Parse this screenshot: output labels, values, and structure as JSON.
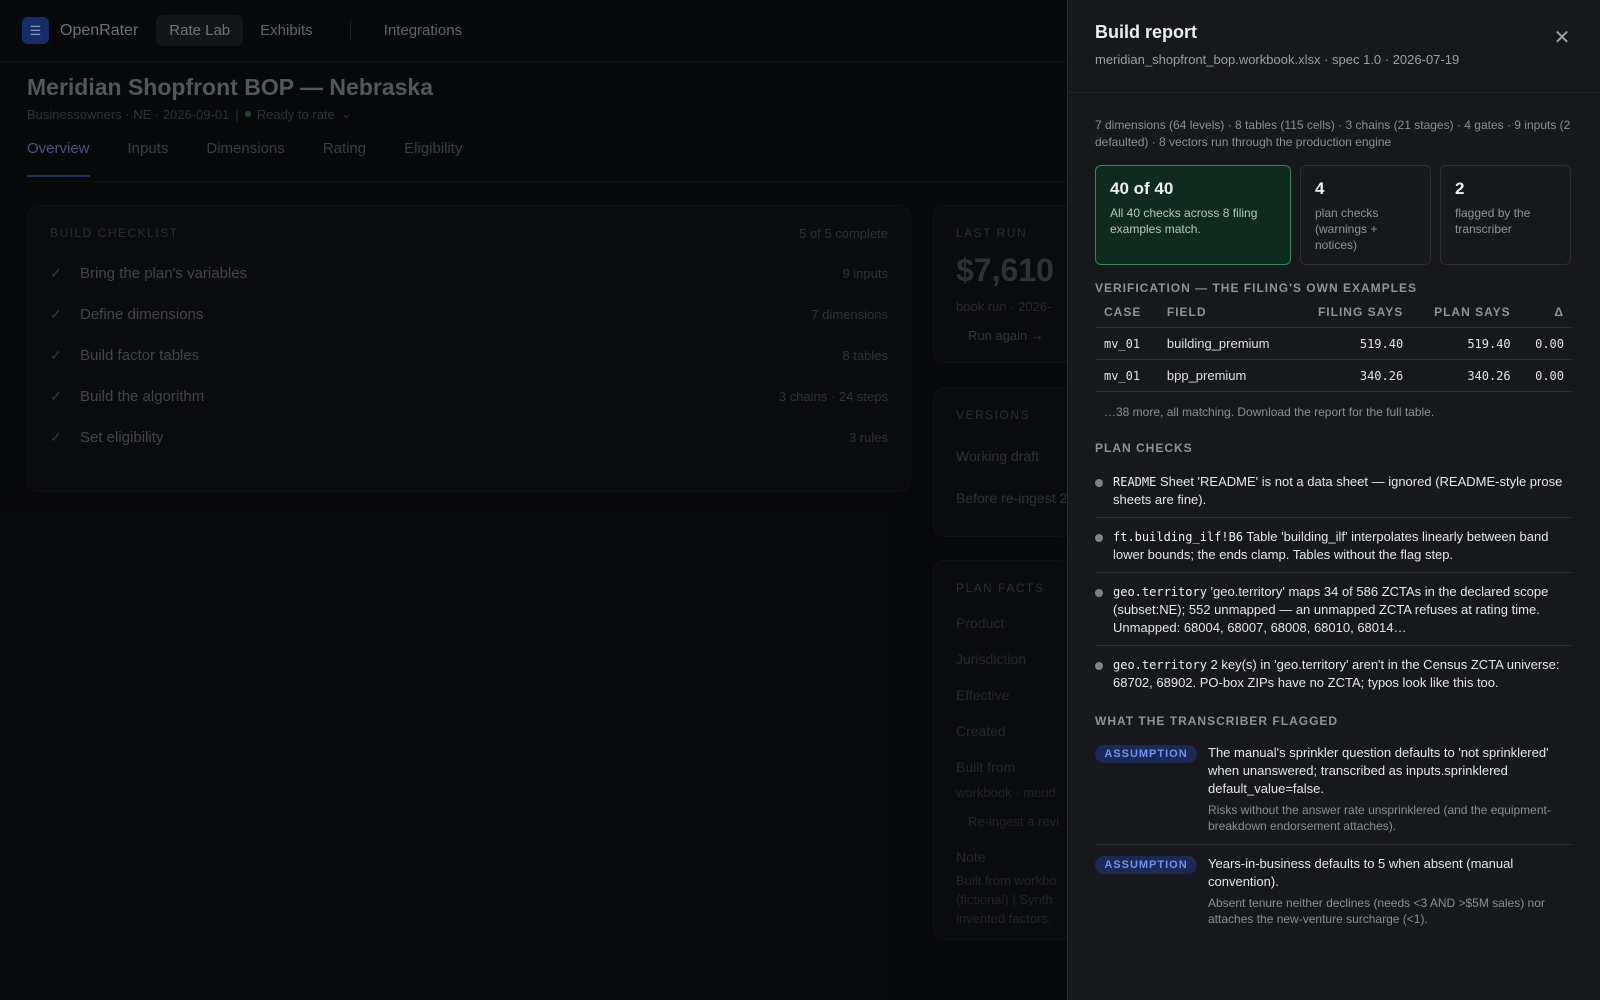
{
  "app": {
    "brand": "OpenRater",
    "nav": [
      "Rate Lab",
      "Exhibits",
      "Integrations"
    ],
    "page_title": "Meridian Shopfront BOP — Nebraska",
    "page_sub": "Businessowners · NE · 2026-09-01",
    "status": "Ready to rate",
    "tabs": [
      "Overview",
      "Inputs",
      "Dimensions",
      "Rating",
      "Eligibility"
    ],
    "checklist": {
      "title": "BUILD CHECKLIST",
      "count": "5 of 5 complete",
      "items": [
        {
          "label": "Bring the plan's variables",
          "meta": "9 inputs"
        },
        {
          "label": "Define dimensions",
          "meta": "7 dimensions"
        },
        {
          "label": "Build factor tables",
          "meta": "8 tables"
        },
        {
          "label": "Build the algorithm",
          "meta": "3 chains · 24 steps"
        },
        {
          "label": "Set eligibility",
          "meta": "3 rules"
        }
      ]
    },
    "last_run": {
      "title": "LAST RUN",
      "price": "$7,610",
      "sub": "book run · 2026-",
      "again": "Run again →"
    },
    "versions": {
      "title": "VERSIONS",
      "items": [
        "Working draft",
        "Before re-ingest 2"
      ]
    },
    "facts": {
      "title": "PLAN FACTS",
      "labels": [
        "Product",
        "Jurisdiction",
        "Effective",
        "Created",
        "Built from"
      ],
      "built_from_value": "workbook · merid",
      "reingest": "Re-ingest a revi",
      "note_label": "Note",
      "note_lines": [
        "Built from workbo",
        "(fictional) | Synth",
        "invented factors."
      ]
    }
  },
  "drawer": {
    "title": "Build report",
    "subtitle": "meridian_shopfront_bop.workbook.xlsx · spec 1.0 · 2026-07-19",
    "summary": "7 dimensions (64 levels) · 8 tables (115 cells) · 3 chains (21 stages) · 4 gates · 9 inputs (2 defaulted) · 8 vectors run through the production engine",
    "stats": [
      {
        "n": "40 of 40",
        "d": "All 40 checks across 8 filing examples match."
      },
      {
        "n": "4",
        "d": "plan checks (warnings + notices)"
      },
      {
        "n": "2",
        "d": "flagged by the transcriber"
      }
    ],
    "verification_title": "VERIFICATION — THE FILING'S OWN EXAMPLES",
    "columns": [
      "CASE",
      "FIELD",
      "FILING SAYS",
      "PLAN SAYS",
      "Δ"
    ],
    "rows": [
      {
        "case": "mv_01",
        "field": "building_premium",
        "filing": "519.40",
        "plan": "519.40",
        "delta": "0.00"
      },
      {
        "case": "mv_01",
        "field": "bpp_premium",
        "filing": "340.26",
        "plan": "340.26",
        "delta": "0.00"
      }
    ],
    "more": "…38 more, all matching. Download the report for the full table.",
    "plan_checks_title": "PLAN CHECKS",
    "plan_checks": [
      {
        "code": "README",
        "text": " Sheet 'README' is not a data sheet — ignored (README-style prose sheets are fine)."
      },
      {
        "code": "ft.building_ilf!B6",
        "text": " Table 'building_ilf' interpolates linearly between band lower bounds; the ends clamp. Tables without the flag step."
      },
      {
        "code": "geo.territory",
        "text": " 'geo.territory' maps 34 of 586 ZCTAs in the declared scope (subset:NE); 552 unmapped — an unmapped ZCTA refuses at rating time. Unmapped: 68004, 68007, 68008, 68010, 68014…"
      },
      {
        "code": "geo.territory",
        "text": " 2 key(s) in 'geo.territory' aren't in the Census ZCTA universe: 68702, 68902. PO-box ZIPs have no ZCTA; typos look like this too."
      }
    ],
    "flagged_title": "WHAT THE TRANSCRIBER FLAGGED",
    "flags": [
      {
        "badge": "ASSUMPTION",
        "main": "The manual's sprinkler question defaults to 'not sprinklered' when unanswered; transcribed as inputs.sprinklered default_value=false.",
        "note": "Risks without the answer rate unsprinklered (and the equipment-breakdown endorsement attaches)."
      },
      {
        "badge": "ASSUMPTION",
        "main": "Years-in-business defaults to 5 when absent (manual convention).",
        "note": "Absent tenure neither declines (needs <3 AND >$5M sales) nor attaches the new-venture surcharge (<1)."
      }
    ],
    "close_icon": "close-icon"
  }
}
